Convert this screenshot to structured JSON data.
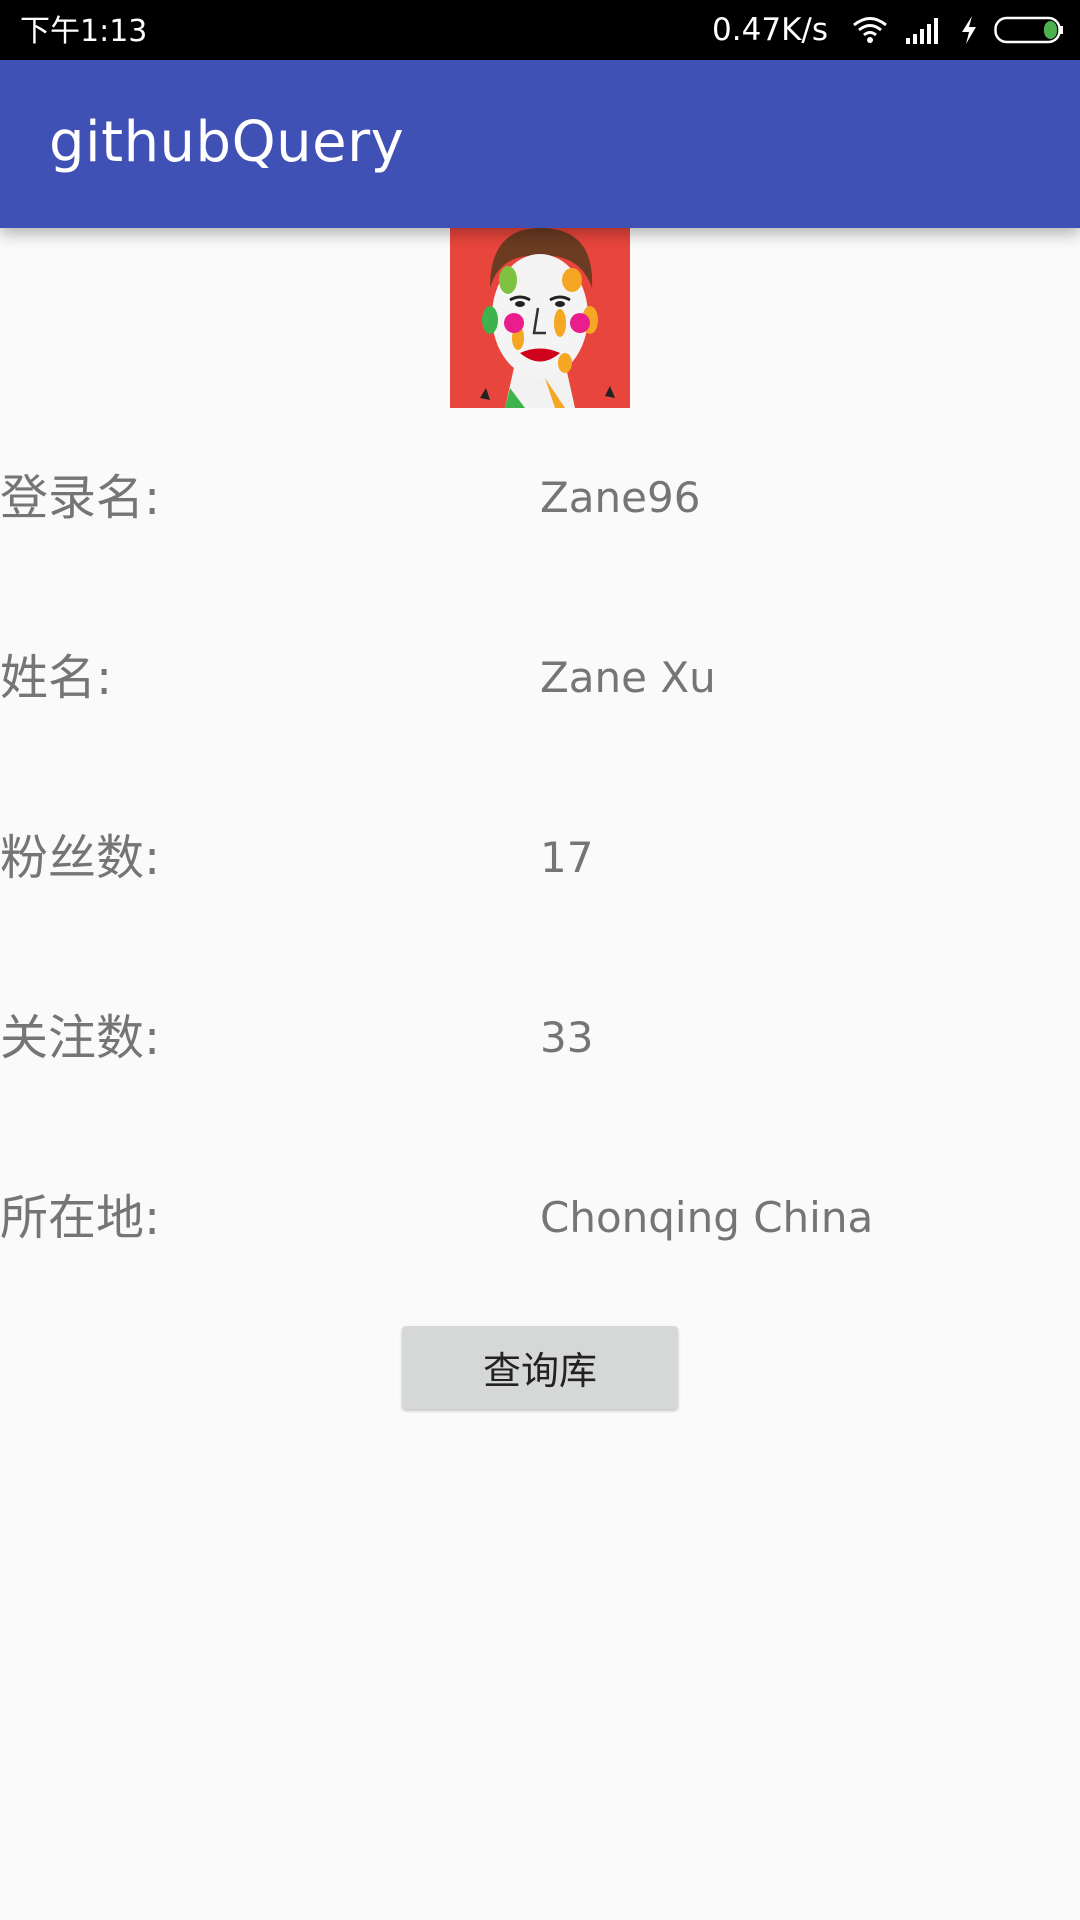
{
  "status_bar": {
    "time": "下午1:13",
    "net_speed": "0.47K/s",
    "icons": [
      "wifi-icon",
      "signal-icon",
      "charging-icon",
      "battery-icon"
    ],
    "battery_color": "#4caf50"
  },
  "app_bar": {
    "title": "githubQuery",
    "color": "#3f51b5"
  },
  "profile": {
    "avatar": "avatar-image",
    "rows": [
      {
        "label": "登录名:",
        "value": "Zane96"
      },
      {
        "label": "姓名:",
        "value": "Zane Xu"
      },
      {
        "label": "粉丝数:",
        "value": "17"
      },
      {
        "label": "关注数:",
        "value": "33"
      },
      {
        "label": "所在地:",
        "value": "Chonqing China"
      }
    ]
  },
  "actions": {
    "query_button_label": "查询库"
  }
}
